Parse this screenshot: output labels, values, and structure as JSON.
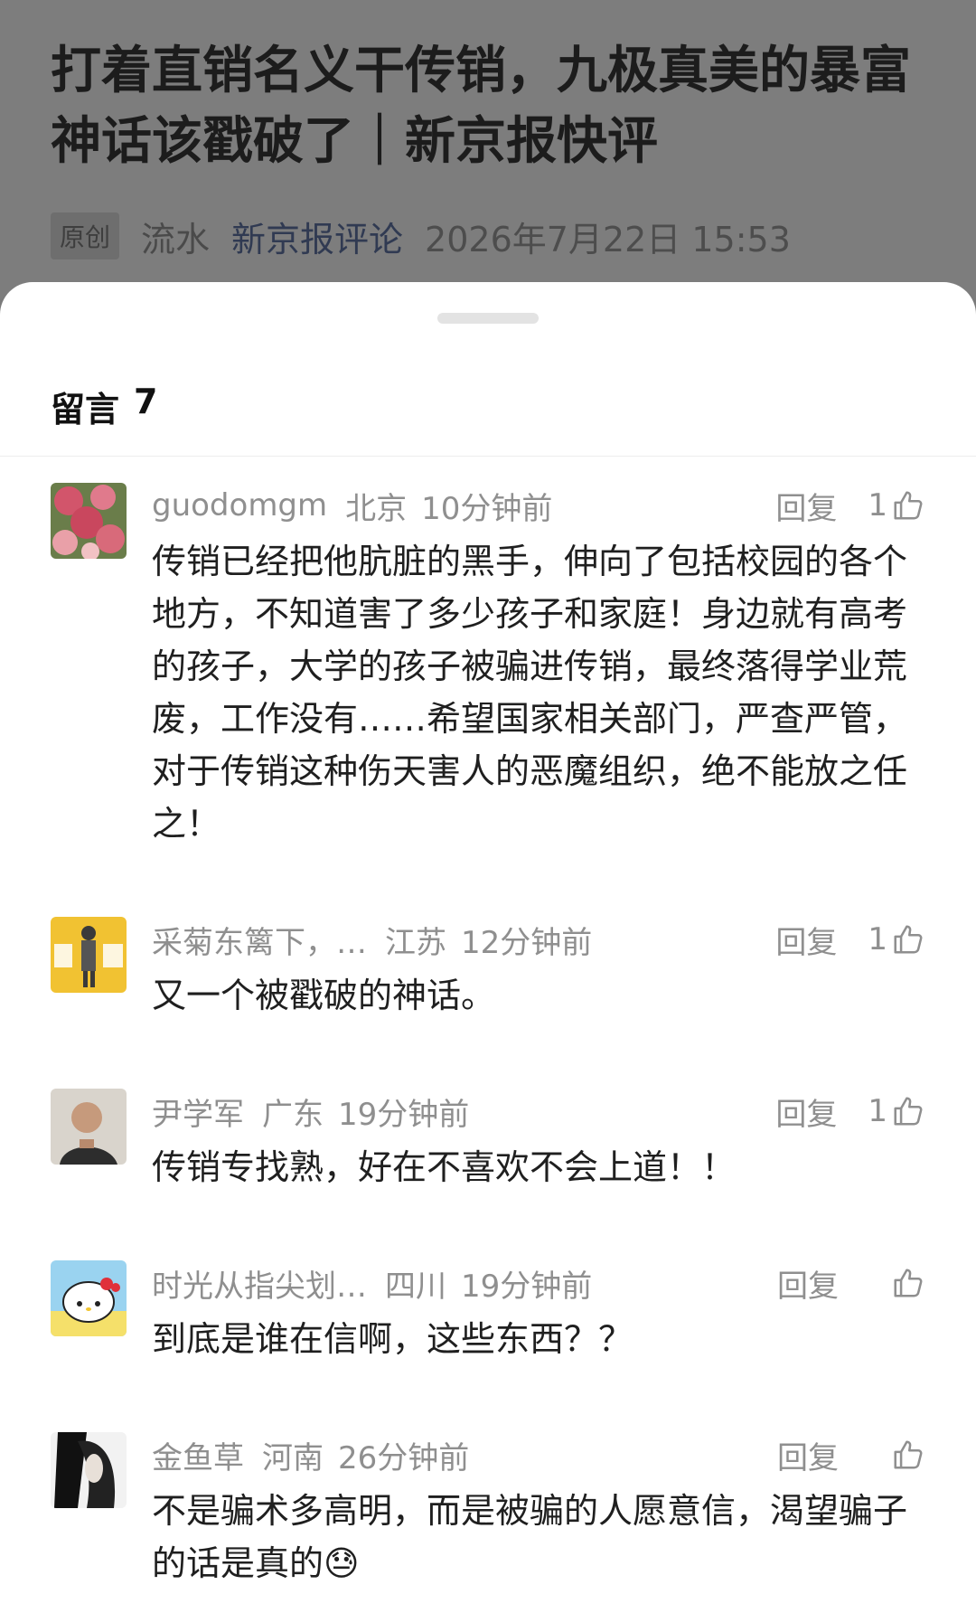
{
  "article": {
    "title": "打着直销名义干传销，九极真美的暴富神话该戳破了｜新京报快评",
    "badge": "原创",
    "author": "流水",
    "account": "新京报评论",
    "datetime": "2026年7月22日 15:53"
  },
  "comments_sheet": {
    "title": "留言",
    "count": "7",
    "reply_label": "回复",
    "comments": [
      {
        "name": "guodomgm",
        "location": "北京",
        "time": "10分钟前",
        "likes": "1",
        "text": "传销已经把他肮脏的黑手，伸向了包括校园的各个地方，不知道害了多少孩子和家庭！身边就有高考的孩子，大学的孩子被骗进传销，最终落得学业荒废，工作没有……希望国家相关部门，严查严管，对于传销这种伤天害人的恶魔组织，绝不能放之任之！"
      },
      {
        "name": "采菊东篱下，…",
        "location": "江苏",
        "time": "12分钟前",
        "likes": "1",
        "text": "又一个被戳破的神话。"
      },
      {
        "name": "尹学军",
        "location": "广东",
        "time": "19分钟前",
        "likes": "1",
        "text": "传销专找熟，好在不喜欢不会上道！！"
      },
      {
        "name": "时光从指尖划…",
        "location": "四川",
        "time": "19分钟前",
        "likes": "",
        "text": "到底是谁在信啊，这些东西？？"
      },
      {
        "name": "金鱼草",
        "location": "河南",
        "time": "26分钟前",
        "likes": "",
        "text": "不是骗术多高明，而是被骗的人愿意信，渴望骗子的话是真的😓"
      }
    ]
  },
  "icons": {
    "like": "thumbs-up-icon",
    "emoji": "sweat-smile-emoji"
  },
  "colors": {
    "overlay": "#7d7d7d",
    "sheet": "#ffffff",
    "meta_text": "#8f8f8f",
    "body_text": "#1f1f1f"
  }
}
